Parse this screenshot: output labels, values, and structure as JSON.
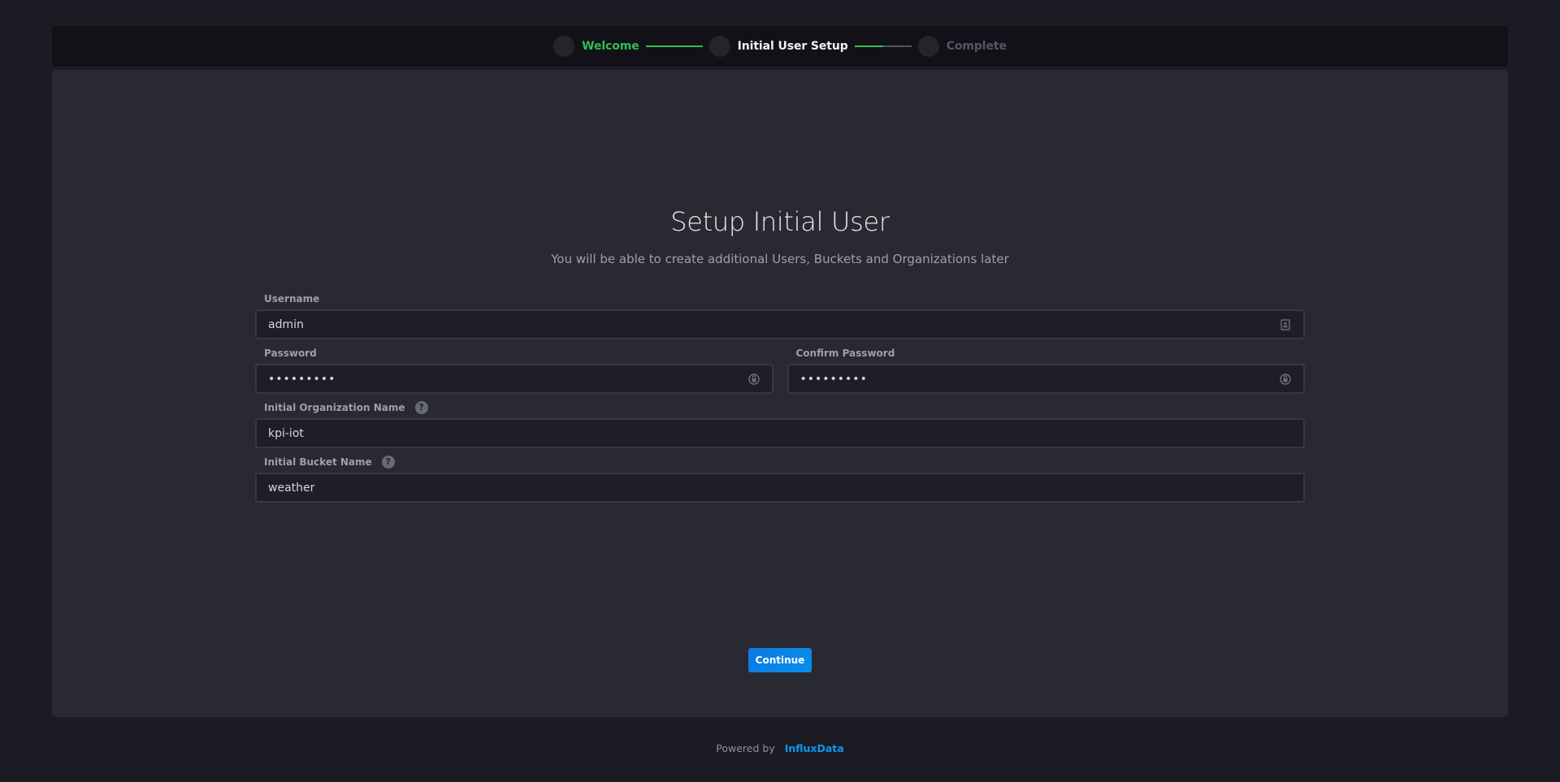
{
  "stepper": {
    "steps": [
      {
        "label": "Welcome",
        "status": "done"
      },
      {
        "label": "Initial User Setup",
        "status": "active"
      },
      {
        "label": "Complete",
        "status": "pending"
      }
    ],
    "connector_progress": [
      1.0,
      0.5
    ],
    "colors": {
      "done": "#34bb55",
      "active": "#f1f1f5",
      "pending": "#545667"
    }
  },
  "main": {
    "title": "Setup Initial User",
    "subtitle": "You will be able to create additional Users, Buckets and Organizations later",
    "fields": {
      "username": {
        "label": "Username",
        "value": "admin",
        "icon": "user-badge-icon"
      },
      "password": {
        "label": "Password",
        "value": "•••••••••",
        "icon": "lock-icon"
      },
      "confirm_password": {
        "label": "Confirm Password",
        "value": "•••••••••",
        "icon": "lock-icon"
      },
      "org": {
        "label": "Initial Organization Name",
        "value": "kpi-iot",
        "help": "?"
      },
      "bucket": {
        "label": "Initial Bucket Name",
        "value": "weather",
        "help": "?"
      }
    },
    "continue_label": "Continue",
    "accent_color": "#0b79e0"
  },
  "footer": {
    "powered_by": "Powered by",
    "brand": "InfluxData"
  }
}
